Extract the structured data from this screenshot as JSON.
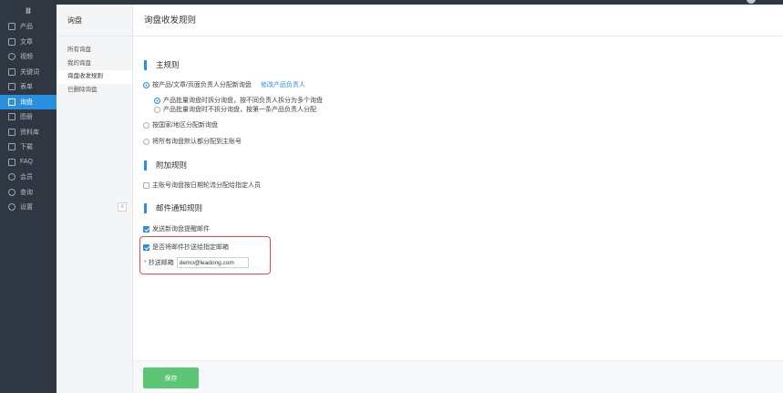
{
  "nav": {
    "collapse_label": "Ⅲ",
    "items": [
      {
        "label": "产品",
        "icon": "grid-icon"
      },
      {
        "label": "文章",
        "icon": "document-icon"
      },
      {
        "label": "视频",
        "icon": "play-icon"
      },
      {
        "label": "关键词",
        "icon": "key-icon"
      },
      {
        "label": "表单",
        "icon": "form-icon"
      },
      {
        "label": "询盘",
        "icon": "inquiry-icon"
      },
      {
        "label": "图册",
        "icon": "album-icon"
      },
      {
        "label": "资料库",
        "icon": "library-icon"
      },
      {
        "label": "下载",
        "icon": "download-icon"
      },
      {
        "label": "FAQ",
        "icon": "faq-icon"
      },
      {
        "label": "会员",
        "icon": "member-icon"
      },
      {
        "label": "查询",
        "icon": "search-icon"
      },
      {
        "label": "设置",
        "icon": "gear-icon"
      }
    ]
  },
  "subnav": {
    "title": "询盘",
    "items": [
      "所有询盘",
      "我的询盘",
      "询盘收发规则",
      "已删除询盘"
    ]
  },
  "main": {
    "page_title": "询盘收发规则",
    "main_rules": {
      "title": "主规则",
      "option_product": "按产品/文章/页面负责人分配新询盘",
      "modify_link": "修改产品负责人",
      "sub_split": "产品批量询盘时拆分询盘，按不同负责人拆分为多个询盘",
      "sub_nosplit": "产品批量询盘时不拆分询盘，按第一条产品负责人分配",
      "option_region": "按国家/地区分配新询盘",
      "option_default": "将所有询盘默认都分配到主账号"
    },
    "extra_rules": {
      "title": "附加规则",
      "option_rotate": "主账号询盘按日期轮流分配给指定人员"
    },
    "email_rules": {
      "title": "邮件通知规则",
      "option_notify": "发送新询盘提醒邮件",
      "option_cc": "是否将邮件抄送给指定邮箱",
      "cc_label": "抄送邮箱",
      "cc_required_mark": "*",
      "cc_value": "demo@leadong.com"
    }
  },
  "footer": {
    "save_label": "保存"
  },
  "colors": {
    "accent": "#2b8fe0",
    "save": "#5bc776",
    "highlight": "#e24b4b",
    "nav_bg": "#2f3742"
  }
}
